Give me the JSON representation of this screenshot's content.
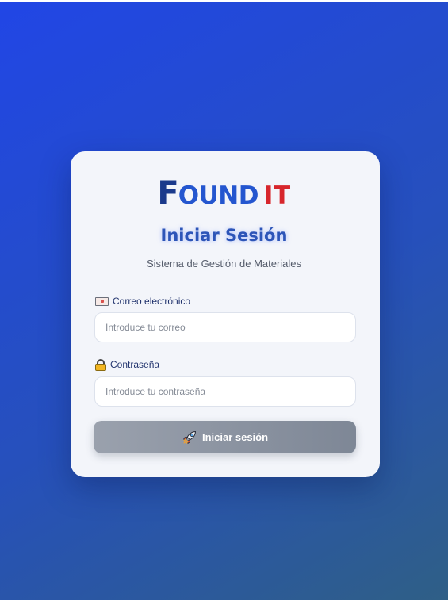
{
  "brand": {
    "first": "F",
    "rest": "OUND",
    "suffix": "IT"
  },
  "heading": "Iniciar Sesión",
  "subtitle": "Sistema de Gestión de Materiales",
  "email": {
    "label": "Correo electrónico",
    "placeholder": "Introduce tu correo",
    "icon": "envelope-icon"
  },
  "password": {
    "label": "Contraseña",
    "placeholder": "Introduce tu contraseña",
    "icon": "lock-icon"
  },
  "submit": {
    "label": "Iniciar sesión",
    "icon": "rocket-icon"
  },
  "colors": {
    "background_start": "#2146e6",
    "background_end": "#2f5f86",
    "brand_dark": "#1b3a8c",
    "brand_blue": "#2456cf",
    "brand_red": "#d7262c",
    "heading": "#2d55b8",
    "button_start": "#9aa1ad",
    "button_end": "#7e8796"
  }
}
